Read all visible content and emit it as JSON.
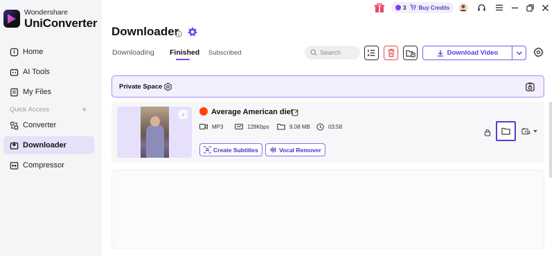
{
  "brand": {
    "top": "Wondershare",
    "name": "UniConverter"
  },
  "sidebar": {
    "items": [
      {
        "label": "Home",
        "icon": "home-icon"
      },
      {
        "label": "AI Tools",
        "icon": "ai-tools-icon"
      },
      {
        "label": "My Files",
        "icon": "files-icon"
      }
    ],
    "quick_access_label": "Quick Access",
    "quick_items": [
      {
        "label": "Converter",
        "icon": "converter-icon"
      },
      {
        "label": "Downloader",
        "icon": "downloader-icon",
        "active": true
      },
      {
        "label": "Compressor",
        "icon": "compressor-icon"
      }
    ]
  },
  "topbar": {
    "credits_count": "3",
    "buy_label": "Buy Credits"
  },
  "page": {
    "title": "Downloader"
  },
  "tabs": [
    {
      "label": "Downloading"
    },
    {
      "label": "Finished",
      "active": true
    },
    {
      "label": "Subscribed"
    }
  ],
  "toolbar": {
    "search_placeholder": "Search",
    "download_label": "Download Video"
  },
  "private_space": {
    "label": "Private Space"
  },
  "item": {
    "title": "Average American diet",
    "format": "MP3",
    "bitrate": "128Kbps",
    "size": "9.08 MB",
    "duration": "03:58",
    "action_subtitles": "Create Subtitles",
    "action_vocal": "Vocal Remover"
  },
  "colors": {
    "accent": "#5b3ad6",
    "active_nav": "#e6e0f8",
    "delete": "#e24b4b",
    "source": "#ff4500"
  }
}
